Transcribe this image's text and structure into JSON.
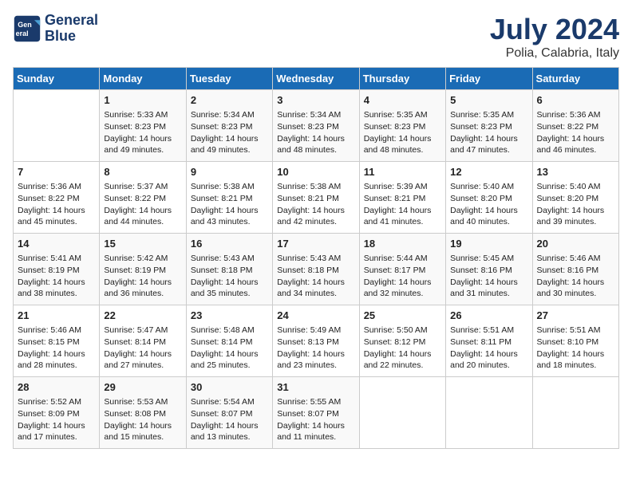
{
  "logo": {
    "line1": "General",
    "line2": "Blue"
  },
  "title": "July 2024",
  "subtitle": "Polia, Calabria, Italy",
  "headers": [
    "Sunday",
    "Monday",
    "Tuesday",
    "Wednesday",
    "Thursday",
    "Friday",
    "Saturday"
  ],
  "weeks": [
    [
      {
        "day": "",
        "info": ""
      },
      {
        "day": "1",
        "info": "Sunrise: 5:33 AM\nSunset: 8:23 PM\nDaylight: 14 hours\nand 49 minutes."
      },
      {
        "day": "2",
        "info": "Sunrise: 5:34 AM\nSunset: 8:23 PM\nDaylight: 14 hours\nand 49 minutes."
      },
      {
        "day": "3",
        "info": "Sunrise: 5:34 AM\nSunset: 8:23 PM\nDaylight: 14 hours\nand 48 minutes."
      },
      {
        "day": "4",
        "info": "Sunrise: 5:35 AM\nSunset: 8:23 PM\nDaylight: 14 hours\nand 48 minutes."
      },
      {
        "day": "5",
        "info": "Sunrise: 5:35 AM\nSunset: 8:23 PM\nDaylight: 14 hours\nand 47 minutes."
      },
      {
        "day": "6",
        "info": "Sunrise: 5:36 AM\nSunset: 8:22 PM\nDaylight: 14 hours\nand 46 minutes."
      }
    ],
    [
      {
        "day": "7",
        "info": "Sunrise: 5:36 AM\nSunset: 8:22 PM\nDaylight: 14 hours\nand 45 minutes."
      },
      {
        "day": "8",
        "info": "Sunrise: 5:37 AM\nSunset: 8:22 PM\nDaylight: 14 hours\nand 44 minutes."
      },
      {
        "day": "9",
        "info": "Sunrise: 5:38 AM\nSunset: 8:21 PM\nDaylight: 14 hours\nand 43 minutes."
      },
      {
        "day": "10",
        "info": "Sunrise: 5:38 AM\nSunset: 8:21 PM\nDaylight: 14 hours\nand 42 minutes."
      },
      {
        "day": "11",
        "info": "Sunrise: 5:39 AM\nSunset: 8:21 PM\nDaylight: 14 hours\nand 41 minutes."
      },
      {
        "day": "12",
        "info": "Sunrise: 5:40 AM\nSunset: 8:20 PM\nDaylight: 14 hours\nand 40 minutes."
      },
      {
        "day": "13",
        "info": "Sunrise: 5:40 AM\nSunset: 8:20 PM\nDaylight: 14 hours\nand 39 minutes."
      }
    ],
    [
      {
        "day": "14",
        "info": "Sunrise: 5:41 AM\nSunset: 8:19 PM\nDaylight: 14 hours\nand 38 minutes."
      },
      {
        "day": "15",
        "info": "Sunrise: 5:42 AM\nSunset: 8:19 PM\nDaylight: 14 hours\nand 36 minutes."
      },
      {
        "day": "16",
        "info": "Sunrise: 5:43 AM\nSunset: 8:18 PM\nDaylight: 14 hours\nand 35 minutes."
      },
      {
        "day": "17",
        "info": "Sunrise: 5:43 AM\nSunset: 8:18 PM\nDaylight: 14 hours\nand 34 minutes."
      },
      {
        "day": "18",
        "info": "Sunrise: 5:44 AM\nSunset: 8:17 PM\nDaylight: 14 hours\nand 32 minutes."
      },
      {
        "day": "19",
        "info": "Sunrise: 5:45 AM\nSunset: 8:16 PM\nDaylight: 14 hours\nand 31 minutes."
      },
      {
        "day": "20",
        "info": "Sunrise: 5:46 AM\nSunset: 8:16 PM\nDaylight: 14 hours\nand 30 minutes."
      }
    ],
    [
      {
        "day": "21",
        "info": "Sunrise: 5:46 AM\nSunset: 8:15 PM\nDaylight: 14 hours\nand 28 minutes."
      },
      {
        "day": "22",
        "info": "Sunrise: 5:47 AM\nSunset: 8:14 PM\nDaylight: 14 hours\nand 27 minutes."
      },
      {
        "day": "23",
        "info": "Sunrise: 5:48 AM\nSunset: 8:14 PM\nDaylight: 14 hours\nand 25 minutes."
      },
      {
        "day": "24",
        "info": "Sunrise: 5:49 AM\nSunset: 8:13 PM\nDaylight: 14 hours\nand 23 minutes."
      },
      {
        "day": "25",
        "info": "Sunrise: 5:50 AM\nSunset: 8:12 PM\nDaylight: 14 hours\nand 22 minutes."
      },
      {
        "day": "26",
        "info": "Sunrise: 5:51 AM\nSunset: 8:11 PM\nDaylight: 14 hours\nand 20 minutes."
      },
      {
        "day": "27",
        "info": "Sunrise: 5:51 AM\nSunset: 8:10 PM\nDaylight: 14 hours\nand 18 minutes."
      }
    ],
    [
      {
        "day": "28",
        "info": "Sunrise: 5:52 AM\nSunset: 8:09 PM\nDaylight: 14 hours\nand 17 minutes."
      },
      {
        "day": "29",
        "info": "Sunrise: 5:53 AM\nSunset: 8:08 PM\nDaylight: 14 hours\nand 15 minutes."
      },
      {
        "day": "30",
        "info": "Sunrise: 5:54 AM\nSunset: 8:07 PM\nDaylight: 14 hours\nand 13 minutes."
      },
      {
        "day": "31",
        "info": "Sunrise: 5:55 AM\nSunset: 8:07 PM\nDaylight: 14 hours\nand 11 minutes."
      },
      {
        "day": "",
        "info": ""
      },
      {
        "day": "",
        "info": ""
      },
      {
        "day": "",
        "info": ""
      }
    ]
  ]
}
